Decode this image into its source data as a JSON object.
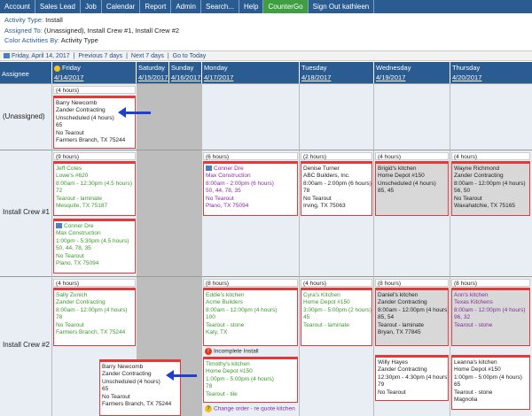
{
  "nav": [
    "Account",
    "Sales Lead",
    "Job",
    "Calendar",
    "Report",
    "Admin",
    "Search...",
    "Help",
    "CounterGo",
    "Sign Out kathleen"
  ],
  "info": {
    "activity_type_label": "Activity Type:",
    "activity_type": "Install",
    "assigned_label": "Assigned To:",
    "assigned": "(Unassigned), Install Crew #1, Install Crew #2",
    "color_label": "Color Activities By:",
    "color": "Activity Type"
  },
  "datebar": {
    "date": "Friday, April 14, 2017",
    "prev": "Previous 7 days",
    "next": "Next 7 days",
    "today": "Go to Today",
    "sep": "|"
  },
  "columns": {
    "assignee": "Assignee",
    "days": [
      {
        "name": "Friday",
        "date": "4/14/2017"
      },
      {
        "name": "Saturday",
        "date": "4/15/2017"
      },
      {
        "name": "Sunday",
        "date": "4/16/2017"
      },
      {
        "name": "Monday",
        "date": "4/17/2017"
      },
      {
        "name": "Tuesday",
        "date": "4/18/2017"
      },
      {
        "name": "Wednesday",
        "date": "4/19/2017"
      },
      {
        "name": "Thursday",
        "date": "4/20/2017"
      }
    ]
  },
  "rows": {
    "unassigned": "(Unassigned)",
    "crew1": "Install Crew #1",
    "crew2": "Install Crew #2"
  },
  "hours": {
    "u_fri": "(4 hours)",
    "c1_fri": "(9 hours)",
    "c1_mon": "(6 hours)",
    "c1_tue": "(2 hours)",
    "c1_wed": "(4 hours)",
    "c1_thu": "(4 hours)",
    "c2_fri": "(4 hours)",
    "c2_mon": "(8 hours)",
    "c2_tue": "(4 hours)",
    "c2_wed": "(8 hours)",
    "c2_thu": "(8 hours)"
  },
  "events": {
    "u1": [
      "Barry Newcomb",
      "Zander Contracting",
      "Unscheduled (4 hours)",
      "65",
      "No Tearout",
      "Farmers Branch, TX 75244"
    ],
    "c1a": [
      "Jeff Cotes",
      "Lowe's #620",
      "8:00am - 12:30pm (4.5 hours)",
      "72",
      "Tearout - laminate",
      "Mesquite, TX 75187"
    ],
    "c1b": [
      "Conner Dre",
      "Max Construction",
      "1:00pm - 5:30pm (4.5 hours)",
      "50, 44, 78, 35",
      "No Tearout",
      "Plano, TX 75094"
    ],
    "c1c": [
      "Conner Dre",
      "Max Construction",
      "8:00am - 2:00pm (6 hours)",
      "50, 44, 78, 35",
      "No Tearout",
      "Plano, TX 75094"
    ],
    "c1d": [
      "Denise Turner",
      "ABC Builders, Inc.",
      "8:00am - 2:00pm (6 hours)",
      "78",
      "No Tearout",
      "Irving, TX 75063"
    ],
    "c1e": [
      "Brigid's kitchen",
      "Home Depot #150",
      "Unscheduled (4 hours)",
      "85, 45"
    ],
    "c1f": [
      "Wayne Richmond",
      "Zander Contracting",
      "8:00am - 12:00pm (4 hours)",
      "56, 50",
      "No Tearout",
      "Waxahatchie, TX 75165"
    ],
    "c2a": [
      "Sally Zunich",
      "Zander Contracting",
      "8:00am - 12:00pm (4 hours)",
      "78",
      "No Tearout",
      "Farmers Branch, TX 75244"
    ],
    "c2b": [
      "Eddie's kitchen",
      "Acme Builders",
      "8:00am - 12:00pm (4 hours)",
      "100",
      "Tearout - stone",
      "Katy, TX"
    ],
    "c2c": [
      "Cyra's Kitchen",
      "Home Depot #150",
      "3:00pm - 5:00pm (2 hours)",
      "45",
      "Tearout - laminate"
    ],
    "c2d": [
      "Daniel's kitchen",
      "Zander Contracting",
      "8:00am - 12:00pm (4 hours)",
      "85, 54",
      "Tearout - laminate",
      "Bryan, TX 77845"
    ],
    "c2e": [
      "Ann's kitchen",
      "Texas Kitchens",
      "8:00am - 12:00pm (4 hours)",
      "96, 32",
      "Tearout - stone"
    ],
    "c2f": [
      "Barry Newcomb",
      "Zander Contracting",
      "Unscheduled (4 hours)",
      "65",
      "No Tearout",
      "Farmers Branch, TX 75244"
    ],
    "c2g": [
      "Timothy's kitchen",
      "Home Depot #150",
      "1:00pm - 5:00pm (4 hours)",
      "78",
      "Tearout - tile"
    ],
    "c2h": [
      "Willy Hayes",
      "Zander Contracting",
      "12:30pm - 4:30pm (4 hours)",
      "79",
      "No Tearout"
    ],
    "c2i": [
      "Leanna's kitchen",
      "Home Depot #150",
      "1:00pm - 5:00pm (4 hours)",
      "65",
      "Tearout - stone",
      "Magnolia"
    ]
  },
  "notes": {
    "incomplete": "Incomplete Install",
    "change": "Change order - re quote kitchen"
  },
  "colors": {
    "nav": "#2a5c92",
    "counterGo": "#3f9e3f",
    "header": "#2a5c92",
    "eventBorder": "#e23a3a",
    "arrow": "#1f3fcf",
    "weekend": "#bdbdbd"
  }
}
